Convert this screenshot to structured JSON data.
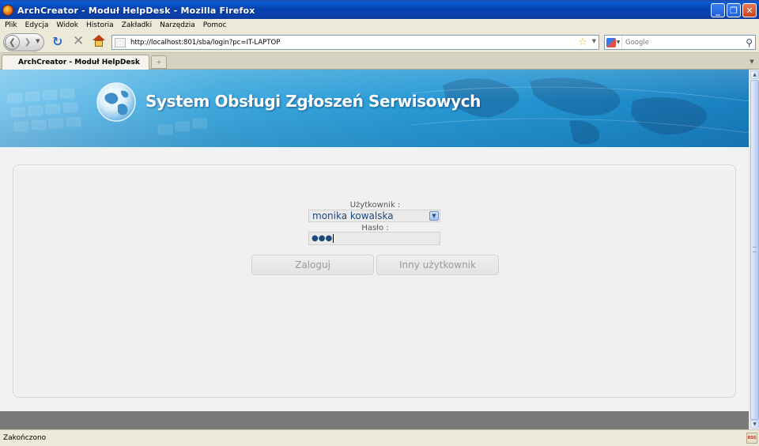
{
  "window": {
    "title": "ArchCreator - Moduł HelpDesk - Mozilla Firefox",
    "buttons": {
      "minimize": "_",
      "maximize": "❐",
      "close": "✕"
    }
  },
  "menu": {
    "items": [
      {
        "label": "Plik"
      },
      {
        "label": "Edycja"
      },
      {
        "label": "Widok"
      },
      {
        "label": "Historia"
      },
      {
        "label": "Zakładki"
      },
      {
        "label": "Narzędzia"
      },
      {
        "label": "Pomoc"
      }
    ]
  },
  "nav": {
    "url": "http://localhost:801/sba/login?pc=IT-LAPTOP",
    "search_placeholder": "Google",
    "icons": {
      "back": "back-arrow-icon",
      "forward": "forward-arrow-icon",
      "reload": "reload-icon",
      "stop": "stop-icon",
      "home": "home-icon",
      "bookmark": "star-icon",
      "search": "magnifier-icon"
    }
  },
  "tabs": {
    "active_label": "ArchCreator - Moduł HelpDesk",
    "new_tab": "+"
  },
  "page": {
    "banner_title": "System Obsługi Zgłoszeń Serwisowych",
    "login": {
      "user_label": "Użytkownik :",
      "user_value": "monika kowalska",
      "password_label": "Hasło :",
      "password_mask": "●●●",
      "login_button": "Zaloguj",
      "other_user_button": "Inny użytkownik"
    }
  },
  "status": {
    "text": "Zakończono",
    "icon_text": "RSS"
  },
  "colors": {
    "titlebar": "#0842b0",
    "banner": "#2a9bd6",
    "panel": "#f0f0f0",
    "select_text": "#1a4a7a",
    "button_text": "#9a9a9a",
    "footer": "#7a7a7a"
  }
}
